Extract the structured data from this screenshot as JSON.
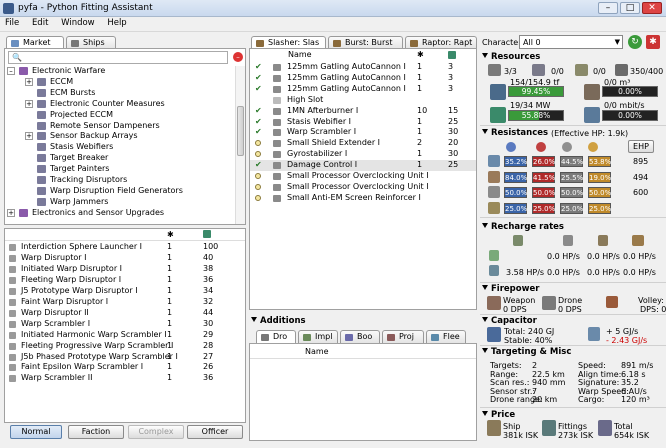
{
  "window": {
    "title": "pyfa - Python Fitting Assistant",
    "minimize": "–",
    "maximize": "□",
    "close": "✕"
  },
  "menu": [
    "File",
    "Edit",
    "Window",
    "Help"
  ],
  "left": {
    "tabs": [
      "Market",
      "Ships"
    ],
    "tree": [
      {
        "label": "Electronic Warfare",
        "depth": 1,
        "exp": "–"
      },
      {
        "label": "ECCM",
        "depth": 2,
        "exp": "+"
      },
      {
        "label": "ECM Bursts",
        "depth": 2,
        "exp": ""
      },
      {
        "label": "Electronic Counter Measures",
        "depth": 2,
        "exp": "+"
      },
      {
        "label": "Projected ECCM",
        "depth": 2,
        "exp": ""
      },
      {
        "label": "Remote Sensor Dampeners",
        "depth": 2,
        "exp": ""
      },
      {
        "label": "Sensor Backup Arrays",
        "depth": 2,
        "exp": "+"
      },
      {
        "label": "Stasis Webifiers",
        "depth": 2,
        "exp": ""
      },
      {
        "label": "Target Breaker",
        "depth": 2,
        "exp": ""
      },
      {
        "label": "Target Painters",
        "depth": 2,
        "exp": ""
      },
      {
        "label": "Tracking Disruptors",
        "depth": 2,
        "exp": ""
      },
      {
        "label": "Warp Disruption Field Generators",
        "depth": 2,
        "exp": ""
      },
      {
        "label": "Warp Jammers",
        "depth": 2,
        "exp": ""
      },
      {
        "label": "Electronics and Sensor Upgrades",
        "depth": 1,
        "exp": "+"
      }
    ],
    "items": [
      {
        "name": "Interdiction Sphere Launcher I",
        "c1": "1",
        "c2": "100"
      },
      {
        "name": "Warp Disruptor I",
        "c1": "1",
        "c2": "40"
      },
      {
        "name": "Initiated Warp Disruptor I",
        "c1": "1",
        "c2": "38"
      },
      {
        "name": "Fleeting Warp Disruptor I",
        "c1": "1",
        "c2": "36"
      },
      {
        "name": "J5 Prototype Warp Disruptor I",
        "c1": "1",
        "c2": "34"
      },
      {
        "name": "Faint Warp Disruptor I",
        "c1": "1",
        "c2": "32"
      },
      {
        "name": "Warp Disruptor II",
        "c1": "1",
        "c2": "44"
      },
      {
        "name": "Warp Scrambler I",
        "c1": "1",
        "c2": "30"
      },
      {
        "name": "Initiated Harmonic Warp Scrambler I",
        "c1": "1",
        "c2": "29"
      },
      {
        "name": "Fleeting Progressive Warp Scrambler I",
        "c1": "1",
        "c2": "28"
      },
      {
        "name": "J5b Phased Prototype Warp Scrambler I",
        "c1": "1",
        "c2": "27"
      },
      {
        "name": "Faint Epsilon Warp Scrambler I",
        "c1": "1",
        "c2": "26"
      },
      {
        "name": "Warp Scrambler II",
        "c1": "1",
        "c2": "36"
      }
    ],
    "buttons": [
      "Normal",
      "Faction",
      "Complex",
      "Officer"
    ]
  },
  "middle": {
    "tabs": [
      "Slasher: Slas",
      "Burst: Burst",
      "Raptor: Rapt"
    ],
    "header_name": "Name",
    "modules": [
      {
        "name": "125mm Gatling AutoCannon I",
        "c1": "1",
        "c2": "3",
        "state": "check"
      },
      {
        "name": "125mm Gatling AutoCannon I",
        "c1": "1",
        "c2": "3",
        "state": "check"
      },
      {
        "name": "125mm Gatling AutoCannon I",
        "c1": "1",
        "c2": "3",
        "state": "check"
      },
      {
        "name": "High Slot",
        "c1": "",
        "c2": "",
        "state": "none"
      },
      {
        "name": "1MN Afterburner I",
        "c1": "10",
        "c2": "15",
        "state": "check"
      },
      {
        "name": "Stasis Webifier I",
        "c1": "1",
        "c2": "25",
        "state": "check"
      },
      {
        "name": "Warp Scrambler I",
        "c1": "1",
        "c2": "30",
        "state": "check"
      },
      {
        "name": "Small Shield Extender I",
        "c1": "2",
        "c2": "20",
        "state": "dot"
      },
      {
        "name": "Gyrostabilizer I",
        "c1": "1",
        "c2": "30",
        "state": "dot"
      },
      {
        "name": "Damage Control I",
        "c1": "1",
        "c2": "25",
        "state": "check"
      },
      {
        "name": "Small Processor Overclocking Unit I",
        "c1": "",
        "c2": "",
        "state": "dot"
      },
      {
        "name": "Small Processor Overclocking Unit I",
        "c1": "",
        "c2": "",
        "state": "dot"
      },
      {
        "name": "Small Anti-EM Screen Reinforcer I",
        "c1": "",
        "c2": "",
        "state": "dot"
      }
    ],
    "additions_title": "Additions",
    "additions_tabs": [
      "Dro",
      "Impl",
      "Boo",
      "Proj",
      "Flee"
    ],
    "additions_header": "Name"
  },
  "right": {
    "character_label": "Character:",
    "character_value": "All 0",
    "resources": {
      "title": "Resources",
      "hardpoints": [
        "3/3",
        "0/0",
        "0/0",
        "350/400"
      ],
      "cpu_text": "154/154.9 tf",
      "cpu_pct": "99.45%",
      "cpu_fill": 0.9945,
      "power_text": "19/34 MW",
      "power_pct": "55.88%",
      "power_fill": 0.5588,
      "drone_bay_text": "0/0 m³",
      "drone_bay_pct": "0.00%",
      "bandwidth_text": "0/0 mbit/s",
      "bandwidth_pct": "0.00%"
    },
    "resistances": {
      "title": "Resistances",
      "ehp_label": "(Effective HP: 1.9k)",
      "ehp_button": "EHP",
      "rows": [
        {
          "vals": [
            "35.2%",
            "26.0%",
            "44.5%",
            "53.8%"
          ],
          "hp": "895"
        },
        {
          "vals": [
            "84.0%",
            "41.5%",
            "25.5%",
            "19.0%"
          ],
          "hp": "494"
        },
        {
          "vals": [
            "50.0%",
            "50.0%",
            "50.0%",
            "50.0%"
          ],
          "hp": "600"
        },
        {
          "vals": [
            "25.0%",
            "25.0%",
            "25.0%",
            "25.0%"
          ],
          "hp": ""
        }
      ],
      "colors": [
        "#3a64a8",
        "#b02a2a",
        "#7a7a7a",
        "#c08a2a"
      ]
    },
    "recharge": {
      "title": "Recharge rates",
      "row1": [
        "0.0 HP/s",
        "0.0 HP/s",
        "0.0 HP/s"
      ],
      "row2": [
        "3.58 HP/s",
        "0.0 HP/s",
        "0.0 HP/s",
        "0.0 HP/s"
      ]
    },
    "firepower": {
      "title": "Firepower",
      "weapon_label": "Weapon",
      "weapon_value": "0 DPS",
      "drone_label": "Drone",
      "drone_value": "0 DPS",
      "volley_label": "Volley: 0",
      "dps_label": "DPS: 0"
    },
    "capacitor": {
      "title": "Capacitor",
      "total": "Total: 240 GJ",
      "stable": "Stable: 40%",
      "plus": "+  5  GJ/s",
      "minus": "- 2.43 GJ/s"
    },
    "targeting": {
      "title": "Targeting & Misc",
      "left": [
        [
          "Targets:",
          "2"
        ],
        [
          "Range:",
          "22.5 km"
        ],
        [
          "Scan res.:",
          "940 mm"
        ],
        [
          "Sensor str.:",
          "7"
        ],
        [
          "Drone range:",
          "20 km"
        ]
      ],
      "right": [
        [
          "Speed:",
          "891 m/s"
        ],
        [
          "Align time:",
          "6.18 s"
        ],
        [
          "Signature:",
          "35.2"
        ],
        [
          "Warp Speed:",
          "6 AU/s"
        ],
        [
          "Cargo:",
          "120 m³"
        ]
      ]
    },
    "price": {
      "title": "Price",
      "ship_label": "Ship",
      "ship_value": "381k ISK",
      "fittings_label": "Fittings",
      "fittings_value": "273k ISK",
      "total_label": "Total",
      "total_value": "654k ISK"
    }
  }
}
